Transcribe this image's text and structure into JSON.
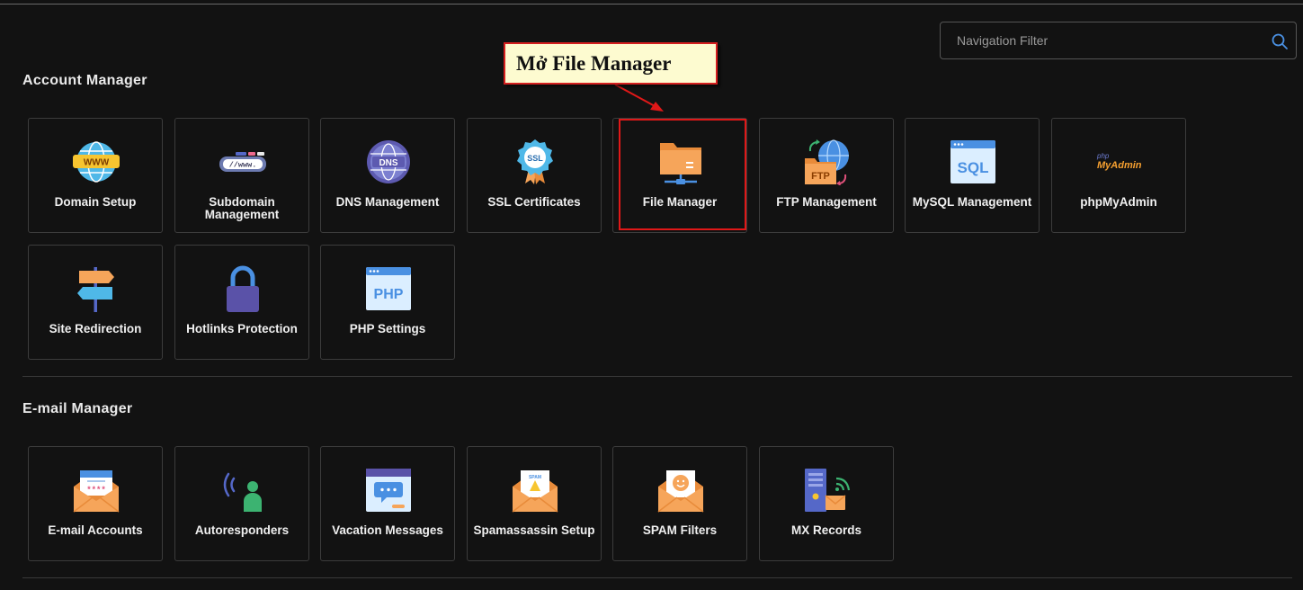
{
  "search": {
    "placeholder": "Navigation Filter",
    "icon": "search-icon"
  },
  "annotation": {
    "text": "Mở File Manager",
    "border_color": "#d41f1f"
  },
  "sections": [
    {
      "title": "Account Manager",
      "items": [
        {
          "label": "Domain Setup",
          "icon": "www-globe-icon"
        },
        {
          "label": "Subdomain Management",
          "icon": "subdomain-bar-icon"
        },
        {
          "label": "DNS Management",
          "icon": "dns-globe-icon"
        },
        {
          "label": "SSL Certificates",
          "icon": "ssl-badge-icon"
        },
        {
          "label": "File Manager",
          "icon": "folder-network-icon"
        },
        {
          "label": "FTP Management",
          "icon": "ftp-folder-icon"
        },
        {
          "label": "MySQL Management",
          "icon": "sql-window-icon"
        },
        {
          "label": "phpMyAdmin",
          "icon": "phpmyadmin-logo-icon"
        },
        {
          "label": "Site Redirection",
          "icon": "signpost-icon"
        },
        {
          "label": "Hotlinks Protection",
          "icon": "padlock-icon"
        },
        {
          "label": "PHP Settings",
          "icon": "php-window-icon"
        }
      ]
    },
    {
      "title": "E-mail Manager",
      "items": [
        {
          "label": "E-mail Accounts",
          "icon": "mail-password-icon"
        },
        {
          "label": "Autoresponders",
          "icon": "person-broadcast-icon"
        },
        {
          "label": "Vacation Messages",
          "icon": "chat-window-icon"
        },
        {
          "label": "Spamassassin Setup",
          "icon": "mail-spam-icon"
        },
        {
          "label": "SPAM Filters",
          "icon": "mail-smiley-icon"
        },
        {
          "label": "MX Records",
          "icon": "server-mail-icon"
        }
      ]
    }
  ],
  "brand": {
    "php": "php",
    "myadmin": "MyAdmin"
  },
  "icon_text": {
    "www": "WWW",
    "sub": "//www.",
    "dns": "DNS",
    "ssl": "SSL",
    "ftp": "FTP",
    "sql": "SQL",
    "php": "PHP",
    "spam": "SPAM",
    "stars": "****"
  },
  "colors": {
    "accent_orange": "#f6a55a",
    "accent_blue": "#4a90e2",
    "highlight": "#e01818"
  }
}
